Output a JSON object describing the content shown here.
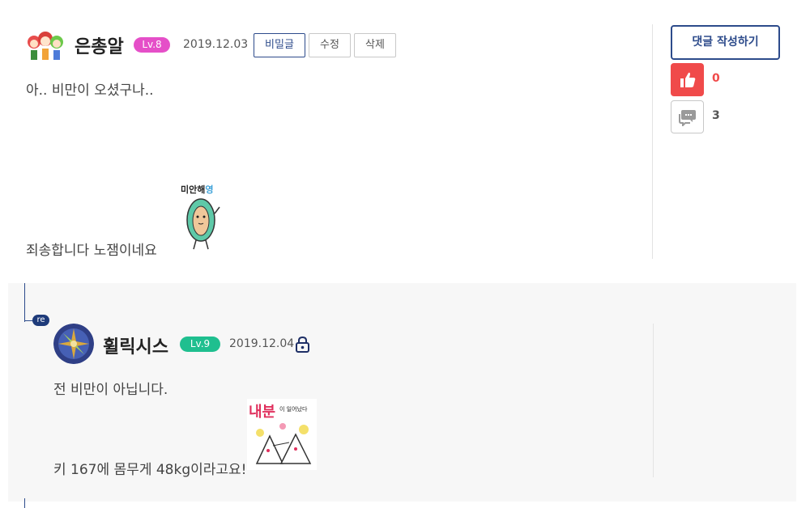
{
  "comment": {
    "nickname": "은총알",
    "level": "Lv.8",
    "level_color": "#e54fc8",
    "date": "2019.12.03",
    "secret_label": "비밀글",
    "edit_label": "수정",
    "delete_label": "삭제",
    "line1": "아.. 비만이 오셨구나..",
    "line2": "죄송합니다 노잼이네요",
    "sticker_text_main": "미안해",
    "sticker_text_accent": "영"
  },
  "sidebar": {
    "write_label": "댓글 작성하기",
    "likes": "0",
    "replies": "3",
    "like_color": "#f04a4a",
    "accent_color": "#2d4b8b"
  },
  "reply": {
    "badge": "re",
    "nickname": "휠릭시스",
    "level": "Lv.9",
    "level_color": "#1fbf8f",
    "date": "2019.12.04",
    "line1": "전 비만이 아닙니다.",
    "line2": "키 167에 몸무게 48kg이라고요!",
    "sticker_text_main": "내분",
    "sticker_text_small": "이 일어났다"
  }
}
